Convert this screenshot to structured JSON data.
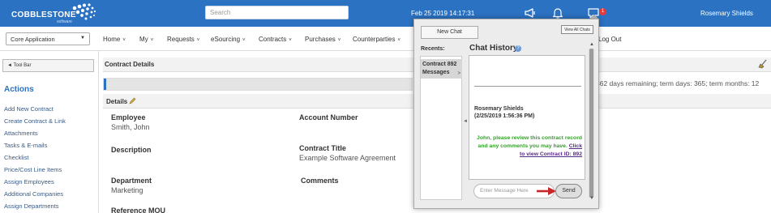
{
  "brand": {
    "name": "COBBLESTONE",
    "sub": "software"
  },
  "topbar": {
    "search_placeholder": "Search",
    "datetime": "Feb 25 2019 14:17:31",
    "notification_count": "1",
    "user": "Rosemary Shields"
  },
  "nav": {
    "app_select": "Core Application",
    "items": [
      "Home",
      "My",
      "Requests",
      "eSourcing",
      "Contracts",
      "Purchases",
      "Counterparties"
    ],
    "logout": "Log Out"
  },
  "sidebar": {
    "toolbar_button": "◄ Tool Bar",
    "actions_title": "Actions",
    "links": [
      "Add New Contract",
      "Create Contract & Link",
      "Attachments",
      "Tasks & E-mails",
      "Checklist",
      "Price/Cost Line Items",
      "Assign Employees",
      "Additional Companies",
      "Assign Departments"
    ]
  },
  "main": {
    "header_title": "Contract Details",
    "progress_percent": 0.7,
    "progress_text": "362 days remaining; term days: 365; term months: 12",
    "details_label": "Details",
    "fields": {
      "employee_label": "Employee",
      "employee_value": "Smith, John",
      "account_label": "Account Number",
      "description_label": "Description",
      "title_label": "Contract Title",
      "title_value": "Example Software Agreement",
      "department_label": "Department",
      "department_value": "Marketing",
      "comments_label": "Comments",
      "reference_label": "Reference MOU"
    }
  },
  "chat": {
    "new_chat": "New Chat",
    "view_all": "View All Chats",
    "recents_label": "Recents:",
    "recent_item_line1": "Contract 892",
    "recent_item_line2": "Messages",
    "history_title": "Chat History",
    "message": {
      "author": "Rosemary Shields",
      "time": "(2/25/2019 1:56:36 PM)",
      "body": "John, please review this contract record and any comments you may have.",
      "link": "Click to view Contract ID: 892"
    },
    "input_placeholder": "Enter Message Here",
    "send": "Send"
  },
  "colors": {
    "brand_blue": "#2b72c2",
    "message_green": "#35a02b",
    "link_purple": "#5a2a86",
    "badge_red": "#e23b3b"
  }
}
